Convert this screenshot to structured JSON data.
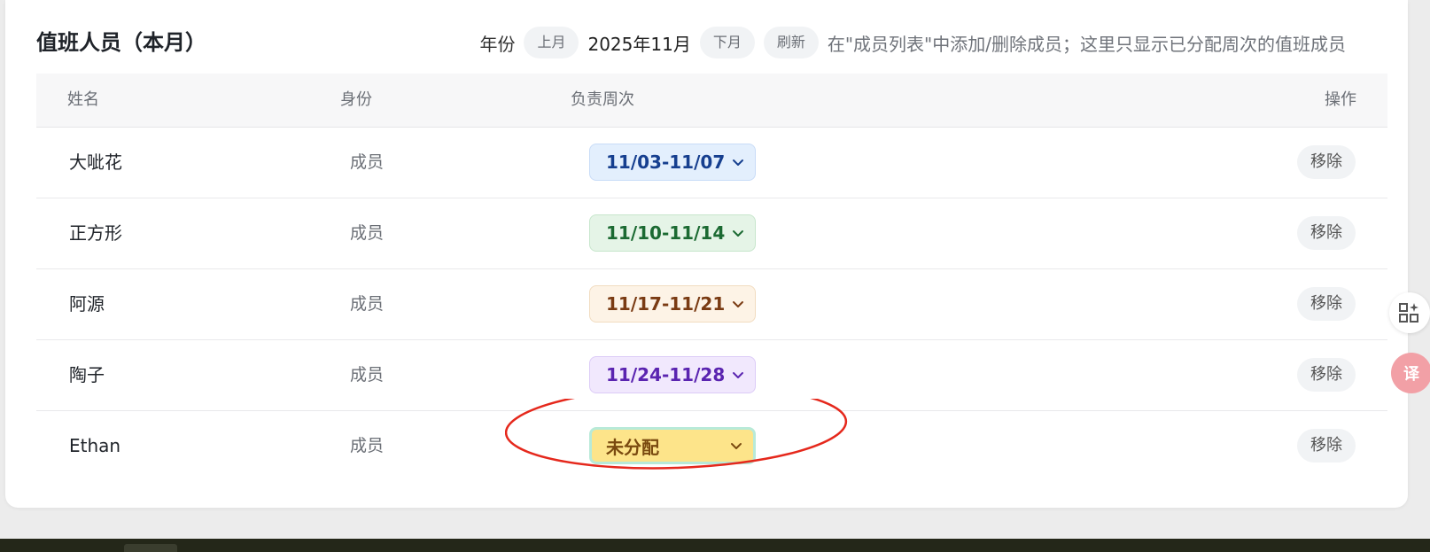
{
  "card": {
    "title": "值班人员（本月）",
    "controls": {
      "year_label": "年份",
      "prev_label": "上月",
      "month_value": "2025年11月",
      "next_label": "下月",
      "refresh_label": "刷新",
      "hint": "在\"成员列表\"中添加/删除成员；这里只显示已分配周次的值班成员"
    }
  },
  "table": {
    "headers": {
      "name": "姓名",
      "role": "身份",
      "week": "负责周次",
      "action": "操作"
    },
    "rows": [
      {
        "name": "大呲花",
        "role": "成员",
        "week": "11/03-11/07",
        "action": "移除"
      },
      {
        "name": "正方形",
        "role": "成员",
        "week": "11/10-11/14",
        "action": "移除"
      },
      {
        "name": "阿源",
        "role": "成员",
        "week": "11/17-11/21",
        "action": "移除"
      },
      {
        "name": "陶子",
        "role": "成员",
        "week": "11/24-11/28",
        "action": "移除"
      },
      {
        "name": "Ethan",
        "role": "成员",
        "week": "未分配",
        "action": "移除"
      }
    ]
  },
  "week_colors": [
    {
      "bg": "#e3effd",
      "border": "#c8dcf7",
      "text": "#163f8f"
    },
    {
      "bg": "#e5f4e7",
      "border": "#c7e6cc",
      "text": "#1b6a32"
    },
    {
      "bg": "#fdf3e6",
      "border": "#f1dcc0",
      "text": "#7a3b13"
    },
    {
      "bg": "#f1e8fd",
      "border": "#dccbf7",
      "text": "#5a24b0"
    },
    {
      "bg": "#fde48a",
      "border": "#b8ead8",
      "text": "#7a4a10"
    }
  ],
  "annotation_color": "#e5281c",
  "side_buttons": {
    "grid_icon": "grid-plus-icon",
    "translate_icon": "translate-icon",
    "translate_glyph": "译"
  }
}
